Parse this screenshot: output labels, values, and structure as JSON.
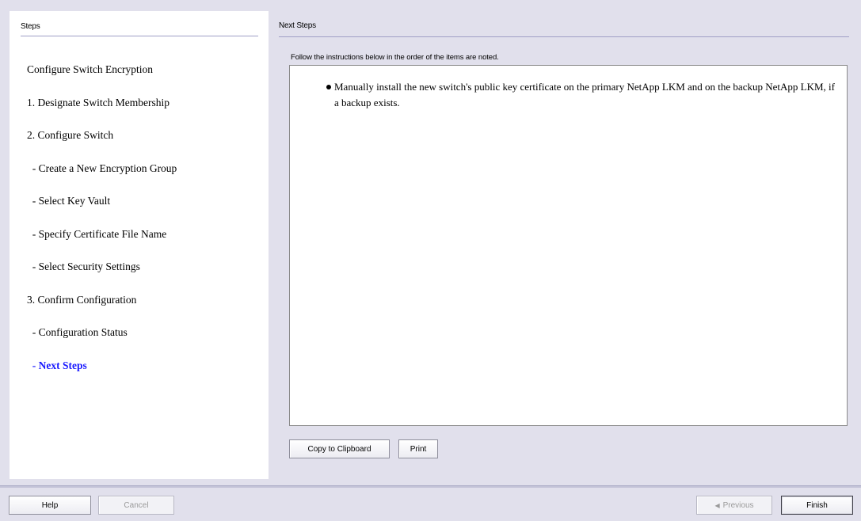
{
  "steps_panel": {
    "title": "Steps",
    "items": [
      {
        "label": "Configure Switch Encryption",
        "active": false
      },
      {
        "label": "1. Designate Switch Membership",
        "active": false
      },
      {
        "label": "2. Configure Switch",
        "active": false
      },
      {
        "label": "  - Create a New Encryption Group",
        "active": false
      },
      {
        "label": "  - Select Key Vault",
        "active": false
      },
      {
        "label": "  - Specify Certificate File Name",
        "active": false
      },
      {
        "label": "  - Select Security Settings",
        "active": false
      },
      {
        "label": "3. Confirm Configuration",
        "active": false
      },
      {
        "label": "  - Configuration Status",
        "active": false
      },
      {
        "label": "  - Next Steps",
        "active": true
      }
    ]
  },
  "main": {
    "title": "Next Steps",
    "instruction": "Follow the instructions below in the order of the items are noted.",
    "bullets": [
      "Manually install the new switch's public key certificate on the primary NetApp LKM and on the backup NetApp LKM, if a backup exists."
    ],
    "copy_button": "Copy to Clipboard",
    "print_button": "Print"
  },
  "footer": {
    "help_button": "Help",
    "cancel_button": "Cancel",
    "previous_button": "Previous",
    "finish_button": "Finish"
  },
  "colors": {
    "background": "#e1e0ec",
    "active_step": "#1a1aff",
    "rule": "#9f9fc6"
  }
}
